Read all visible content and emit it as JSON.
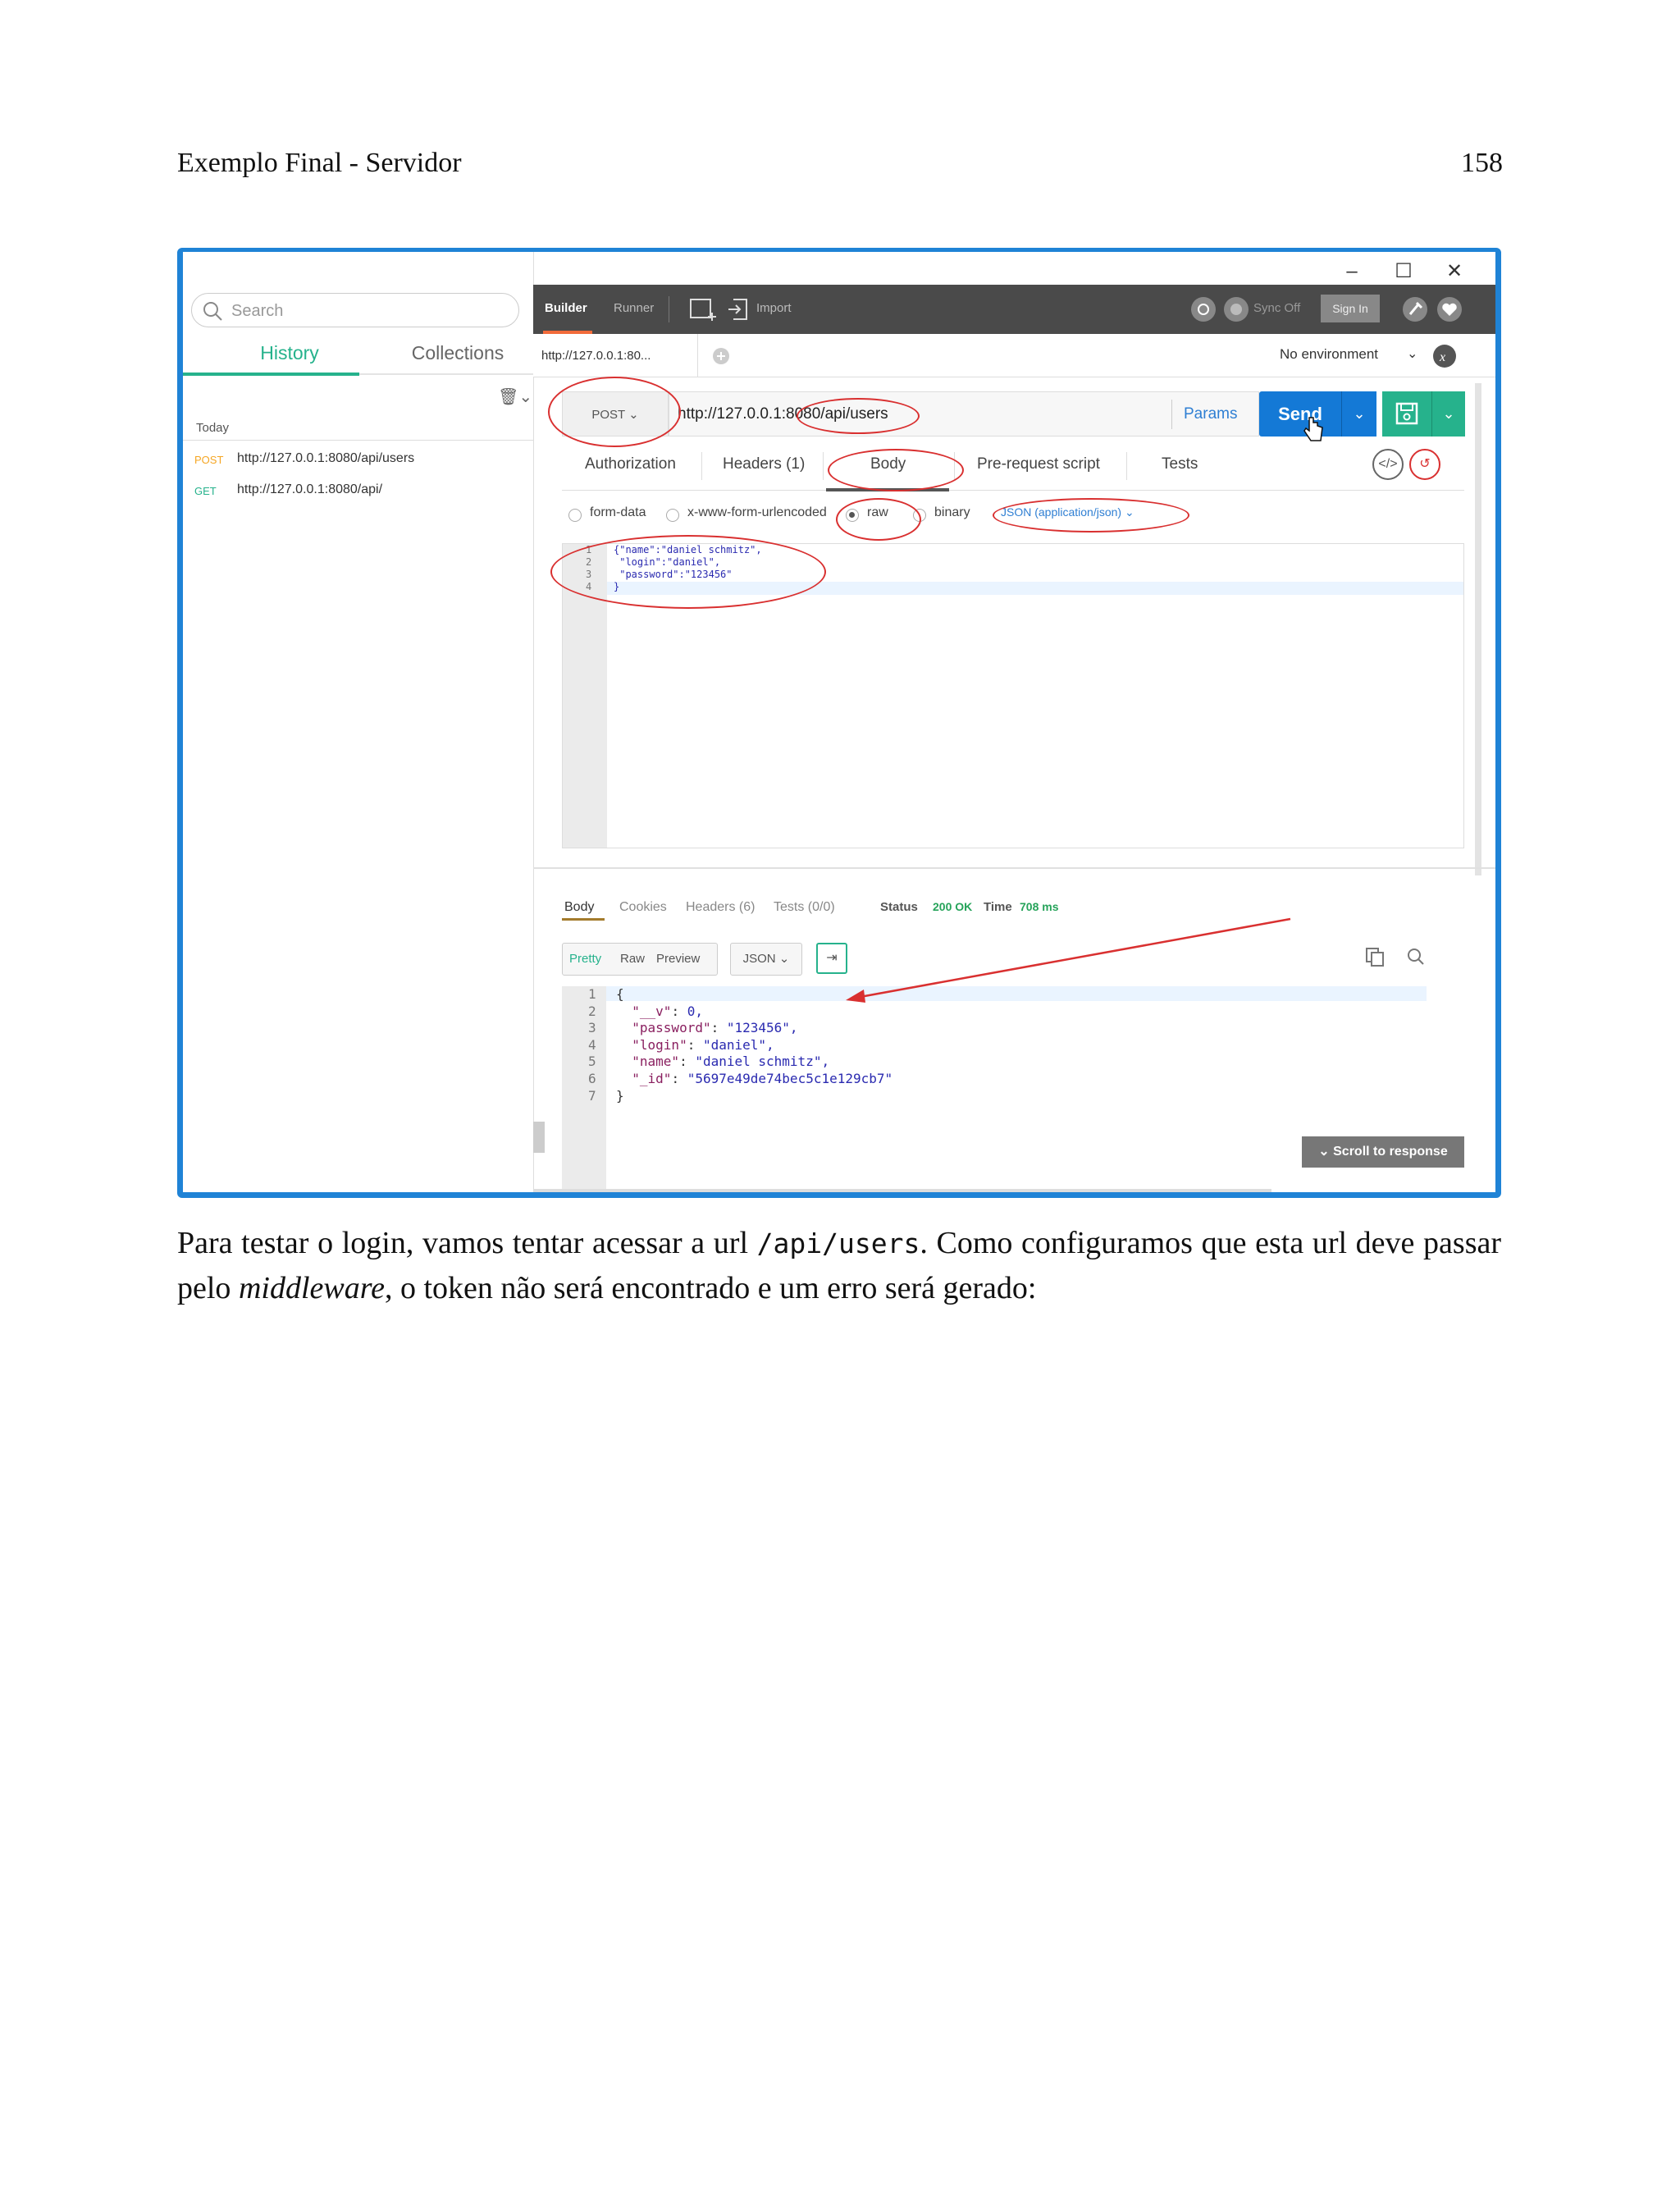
{
  "header": {
    "title": "Exemplo Final - Servidor",
    "page_number": "158"
  },
  "window": {
    "minimize": "–",
    "maximize": "☐",
    "close": "✕"
  },
  "left_panel": {
    "search_placeholder": "Search",
    "tabs": [
      "History",
      "Collections"
    ],
    "group_label": "Today",
    "history": [
      {
        "method": "POST",
        "url": "http://127.0.0.1:8080/api/users",
        "color": "#f5a623"
      },
      {
        "method": "GET",
        "url": "http://127.0.0.1:8080/api/",
        "color": "#26b28c"
      }
    ]
  },
  "toolbar": {
    "builder": "Builder",
    "runner": "Runner",
    "import": "Import",
    "sync": "Sync Off",
    "sign_in": "Sign In"
  },
  "tab_bar": {
    "request_tab": "http://127.0.0.1:80...",
    "environment": "No environment"
  },
  "request": {
    "method": "POST",
    "url": "http://127.0.0.1:8080/api/users",
    "params": "Params",
    "send": "Send",
    "tabs": [
      "Authorization",
      "Headers (1)",
      "Body",
      "Pre-request script",
      "Tests"
    ],
    "body_types": [
      "form-data",
      "x-www-form-urlencoded",
      "raw",
      "binary"
    ],
    "selected_body_type": "raw",
    "content_type": "JSON (application/json)",
    "body_lines": [
      {
        "n": "1",
        "code": "{\"name\":\"daniel schmitz\","
      },
      {
        "n": "2",
        "code": " \"login\":\"daniel\","
      },
      {
        "n": "3",
        "code": " \"password\":\"123456\""
      },
      {
        "n": "4",
        "code": "}"
      }
    ]
  },
  "response": {
    "tabs": [
      "Body",
      "Cookies",
      "Headers (6)",
      "Tests (0/0)"
    ],
    "status_label": "Status",
    "status_value": "200 OK",
    "time_label": "Time",
    "time_value": "708 ms",
    "views": [
      "Pretty",
      "Raw",
      "Preview"
    ],
    "format": "JSON",
    "lines": [
      {
        "n": "1",
        "key": "",
        "sep": "",
        "val": "{"
      },
      {
        "n": "2",
        "key": "\"__v\"",
        "sep": ": ",
        "val": "0,"
      },
      {
        "n": "3",
        "key": "\"password\"",
        "sep": ": ",
        "val": "\"123456\","
      },
      {
        "n": "4",
        "key": "\"login\"",
        "sep": ": ",
        "val": "\"daniel\","
      },
      {
        "n": "5",
        "key": "\"name\"",
        "sep": ": ",
        "val": "\"daniel schmitz\","
      },
      {
        "n": "6",
        "key": "\"_id\"",
        "sep": ": ",
        "val": "\"5697e49de74bec5c1e129cb7\""
      },
      {
        "n": "7",
        "key": "",
        "sep": "",
        "val": "}"
      }
    ],
    "scroll_button": "Scroll to response"
  },
  "paragraph": {
    "part1": "Para testar o login, vamos tentar acessar a url ",
    "code": "/api/users",
    "part2": ". Como configuramos que esta url deve passar pelo ",
    "emph": "middleware",
    "part3": ", o token não será encontrado e um erro será gerado:"
  },
  "colors": {
    "frame": "#1f83d6",
    "send": "#1479d6",
    "save": "#26b28c",
    "annotation": "#d93030"
  }
}
